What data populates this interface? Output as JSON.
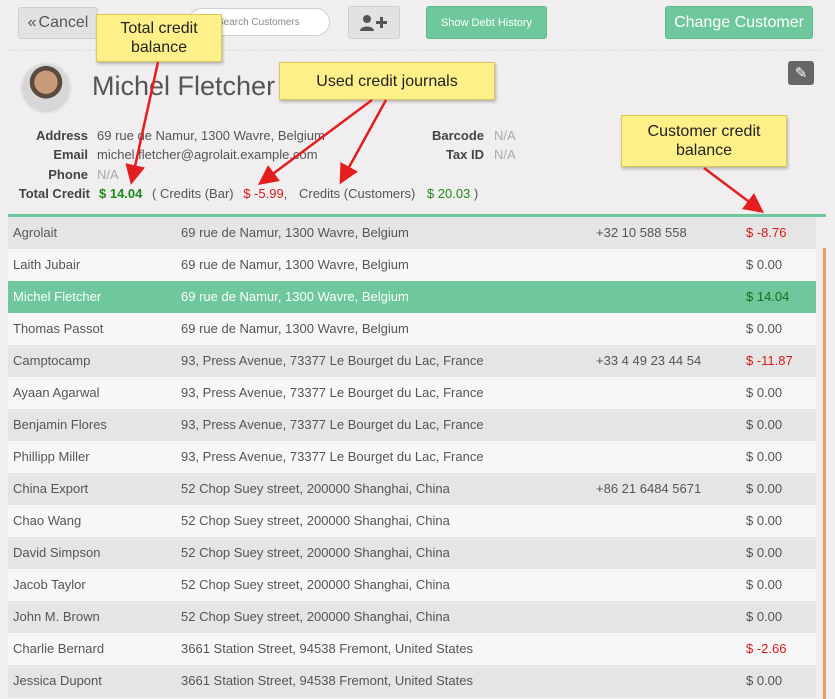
{
  "toolbar": {
    "cancel_icon": "«",
    "cancel_label": "Cancel",
    "search_placeholder": "Search Customers",
    "add_user_icon": "user-plus-icon",
    "debt_history_label": "Show Debt History",
    "change_customer_label": "Change Customer"
  },
  "customer": {
    "name": "Michel Fletcher",
    "address_label": "Address",
    "address": "69 rue de Namur, 1300 Wavre, Belgium",
    "email_label": "Email",
    "email": "michel.fletcher@agrolait.example.com",
    "phone_label": "Phone",
    "phone": "N/A",
    "barcode_label": "Barcode",
    "barcode": "N/A",
    "taxid_label": "Tax ID",
    "taxid": "N/A",
    "total_credit_label": "Total Credit",
    "total_credit": "$ 14.04",
    "credits_open": "( Credits (Bar)",
    "credits_bar_value": "$ -5.99",
    "credits_sep": ",",
    "credits_customers_label": "Credits (Customers)",
    "credits_customers_value": "$ 20.03",
    "credits_close": ")"
  },
  "callouts": {
    "total_credit": "Total credit balance",
    "used_journals": "Used credit journals",
    "customer_credit": "Customer credit balance"
  },
  "colors": {
    "accent": "#6ec89b",
    "positive": "#1c8a1c",
    "negative": "#d61a1a",
    "callout": "#fdf089"
  },
  "customers": [
    {
      "name": "Agrolait",
      "address": "69 rue de Namur, 1300 Wavre, Belgium",
      "phone": "+32 10 588 558",
      "balance": "$ -8.76",
      "neg": true
    },
    {
      "name": "Laith Jubair",
      "address": "69 rue de Namur, 1300 Wavre, Belgium",
      "phone": "",
      "balance": "$ 0.00"
    },
    {
      "name": "Michel Fletcher",
      "address": "69 rue de Namur, 1300 Wavre, Belgium",
      "phone": "",
      "balance": "$ 14.04",
      "selected": true
    },
    {
      "name": "Thomas Passot",
      "address": "69 rue de Namur, 1300 Wavre, Belgium",
      "phone": "",
      "balance": "$ 0.00"
    },
    {
      "name": "Camptocamp",
      "address": "93, Press Avenue, 73377 Le Bourget du Lac, France",
      "phone": "+33 4 49 23 44 54",
      "balance": "$ -11.87",
      "neg": true
    },
    {
      "name": "Ayaan Agarwal",
      "address": "93, Press Avenue, 73377 Le Bourget du Lac, France",
      "phone": "",
      "balance": "$ 0.00"
    },
    {
      "name": "Benjamin Flores",
      "address": "93, Press Avenue, 73377 Le Bourget du Lac, France",
      "phone": "",
      "balance": "$ 0.00"
    },
    {
      "name": "Phillipp Miller",
      "address": "93, Press Avenue, 73377 Le Bourget du Lac, France",
      "phone": "",
      "balance": "$ 0.00"
    },
    {
      "name": "China Export",
      "address": "52 Chop Suey street, 200000 Shanghai, China",
      "phone": "+86 21 6484 5671",
      "balance": "$ 0.00"
    },
    {
      "name": "Chao Wang",
      "address": "52 Chop Suey street, 200000 Shanghai, China",
      "phone": "",
      "balance": "$ 0.00"
    },
    {
      "name": "David Simpson",
      "address": "52 Chop Suey street, 200000 Shanghai, China",
      "phone": "",
      "balance": "$ 0.00"
    },
    {
      "name": "Jacob Taylor",
      "address": "52 Chop Suey street, 200000 Shanghai, China",
      "phone": "",
      "balance": "$ 0.00"
    },
    {
      "name": "John M. Brown",
      "address": "52 Chop Suey street, 200000 Shanghai, China",
      "phone": "",
      "balance": "$ 0.00"
    },
    {
      "name": "Charlie Bernard",
      "address": "3661 Station Street, 94538 Fremont, United States",
      "phone": "",
      "balance": "$ -2.66",
      "neg": true
    },
    {
      "name": "Jessica Dupont",
      "address": "3661 Station Street, 94538 Fremont, United States",
      "phone": "",
      "balance": "$ 0.00"
    }
  ]
}
